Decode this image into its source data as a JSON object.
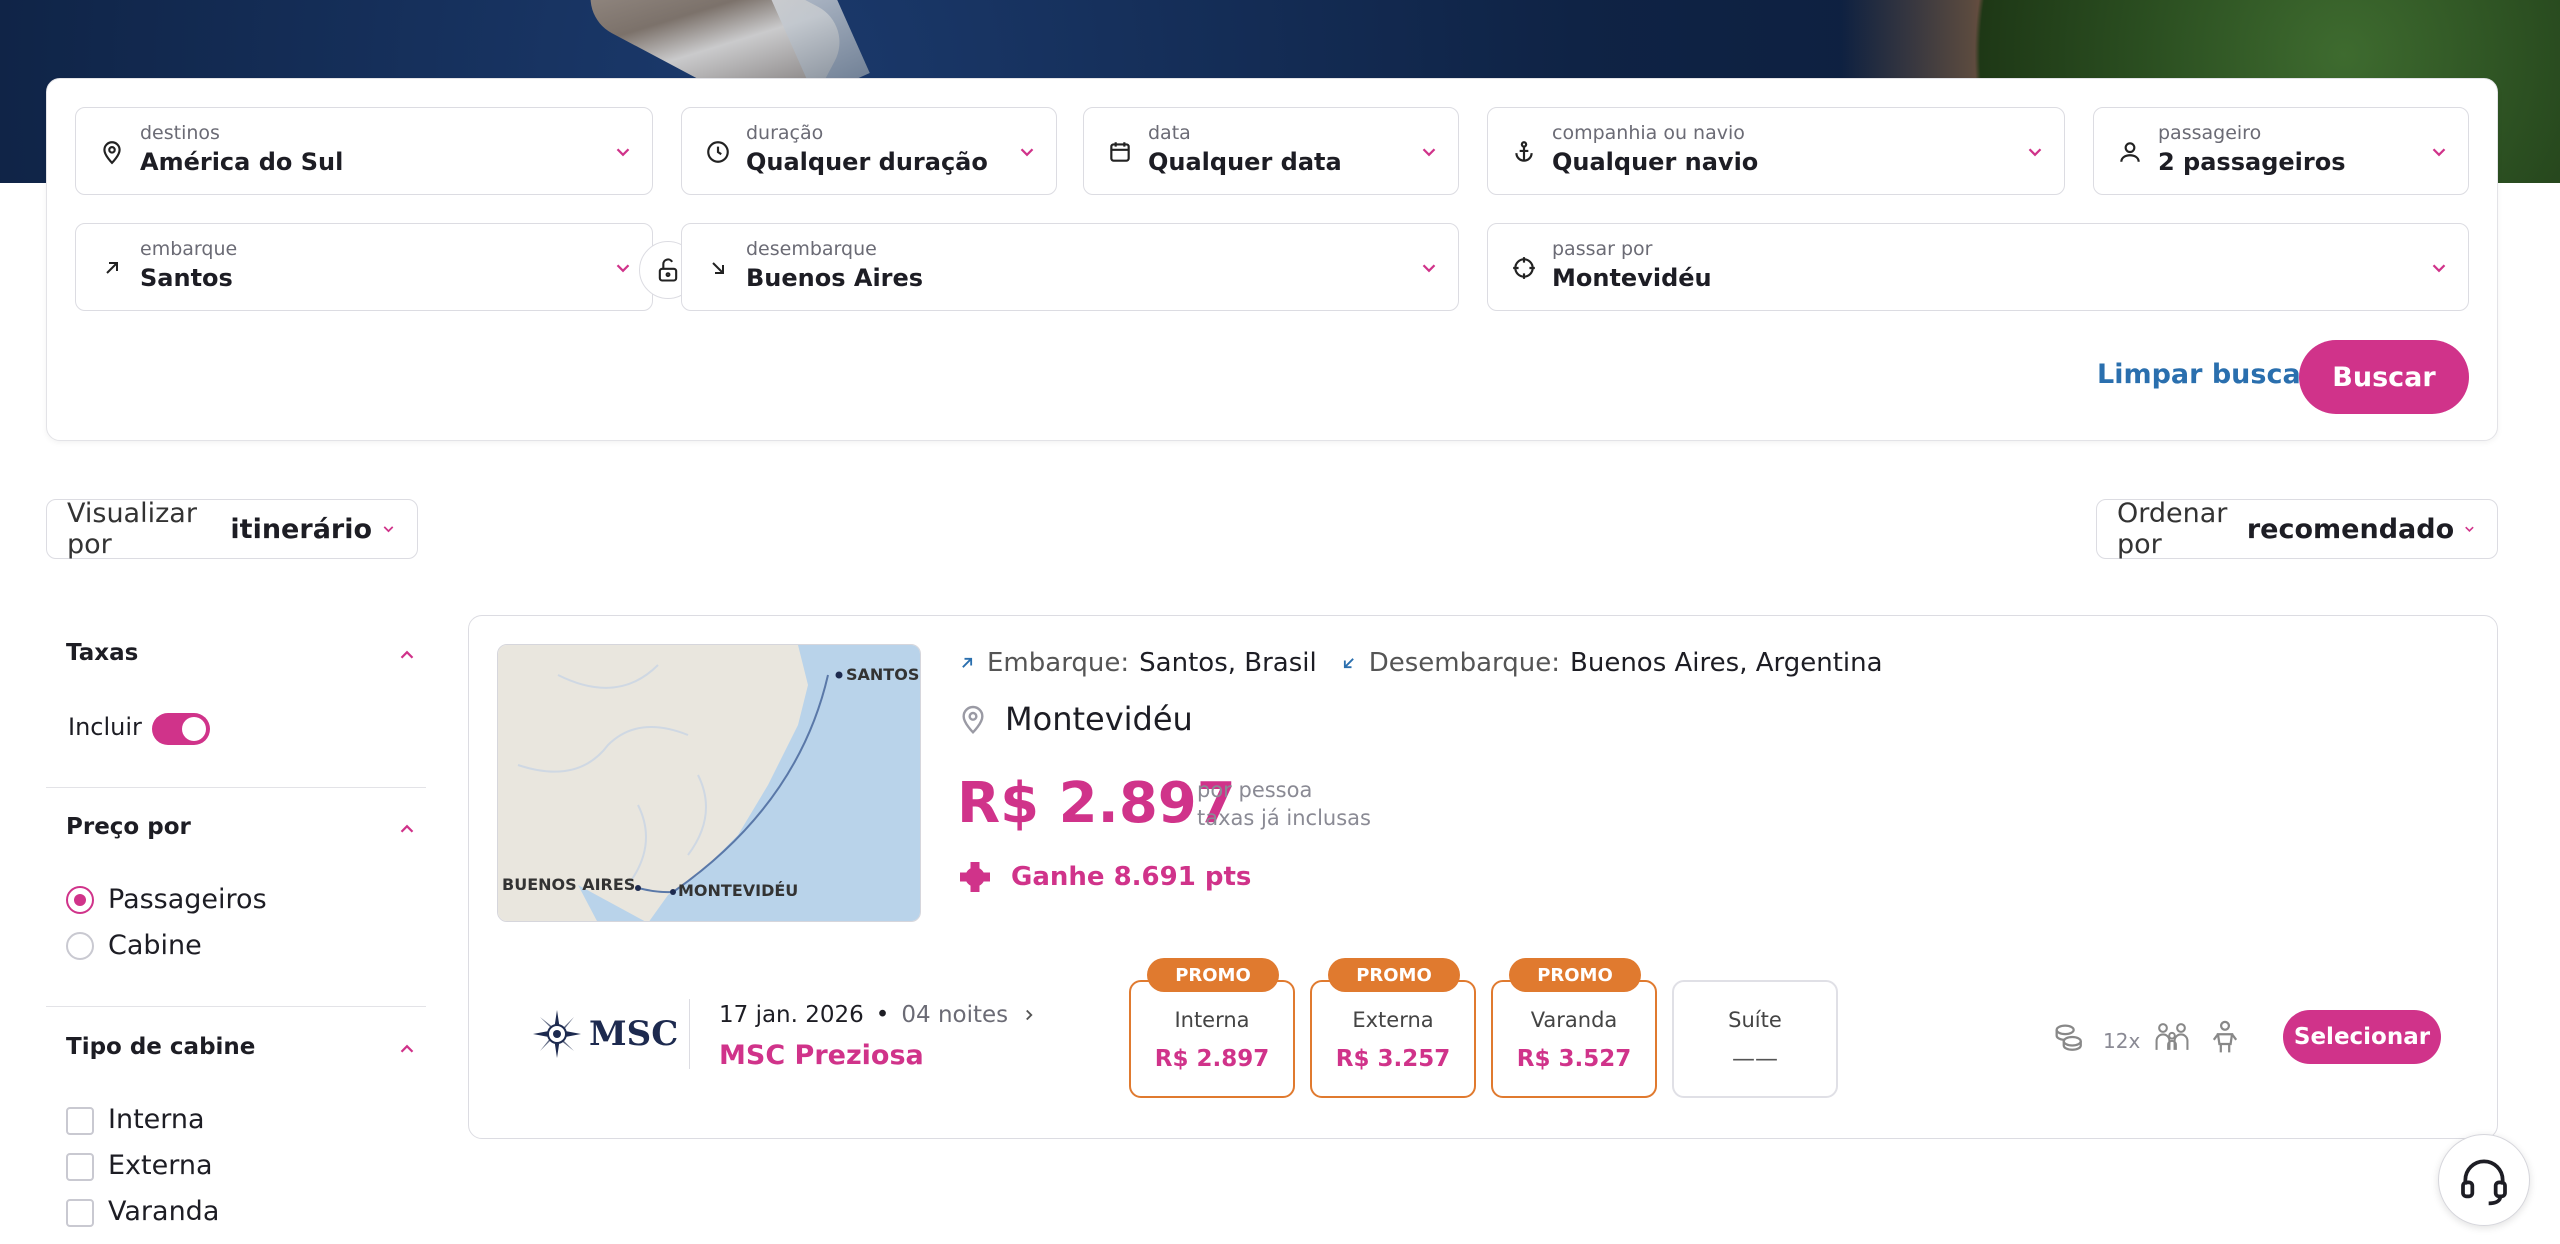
{
  "search": {
    "destinos": {
      "label": "destinos",
      "value": "América do Sul"
    },
    "duracao": {
      "label": "duração",
      "value": "Qualquer duração"
    },
    "data": {
      "label": "data",
      "value": "Qualquer data"
    },
    "companhia": {
      "label": "companhia ou navio",
      "value": "Qualquer navio"
    },
    "passageiro": {
      "label": "passageiro",
      "value": "2 passageiros"
    },
    "embarque": {
      "label": "embarque",
      "value": "Santos"
    },
    "desembarque": {
      "label": "desembarque",
      "value": "Buenos Aires"
    },
    "passar_por": {
      "label": "passar por",
      "value": "Montevidéu"
    },
    "clear_label": "Limpar busca",
    "search_label": "Buscar"
  },
  "toolbar": {
    "view_prefix": "Visualizar por",
    "view_value": "itinerário",
    "sort_prefix": "Ordenar por",
    "sort_value": "recomendado"
  },
  "filters": {
    "taxas": {
      "title": "Taxas",
      "toggle_label": "Incluir",
      "toggle_on": true
    },
    "preco_por": {
      "title": "Preço por",
      "options": [
        "Passageiros",
        "Cabine"
      ],
      "selected": "Passageiros"
    },
    "tipo_cabine": {
      "title": "Tipo de cabine",
      "options": [
        "Interna",
        "Externa",
        "Varanda"
      ]
    }
  },
  "result": {
    "map_labels": {
      "santos": "SANTOS",
      "buenos_aires": "BUENOS AIRES",
      "montevideu": "MONTEVIDÉU"
    },
    "embarque_label": "Embarque:",
    "embarque_value": "Santos, Brasil",
    "desembarque_label": "Desembarque:",
    "desembarque_value": "Buenos Aires, Argentina",
    "via": "Montevidéu",
    "price": "R$ 2.897",
    "price_note_1": "por pessoa",
    "price_note_2": "taxas já inclusas",
    "points": "Ganhe 8.691 pts",
    "brand": "MSC",
    "date": "17 jan. 2026",
    "bullet": "•",
    "nights": "04 noites",
    "ship": "MSC Preziosa",
    "cabins": [
      {
        "badge": "PROMO",
        "name": "Interna",
        "price": "R$ 2.897"
      },
      {
        "badge": "PROMO",
        "name": "Externa",
        "price": "R$ 3.257"
      },
      {
        "badge": "PROMO",
        "name": "Varanda",
        "price": "R$ 3.527"
      },
      {
        "badge": "",
        "name": "Suíte",
        "price": "——"
      }
    ],
    "installments": "12x",
    "select_label": "Selecionar"
  },
  "colors": {
    "accent": "#d0338a",
    "promo": "#e07a2f",
    "link": "#2a6fae"
  }
}
